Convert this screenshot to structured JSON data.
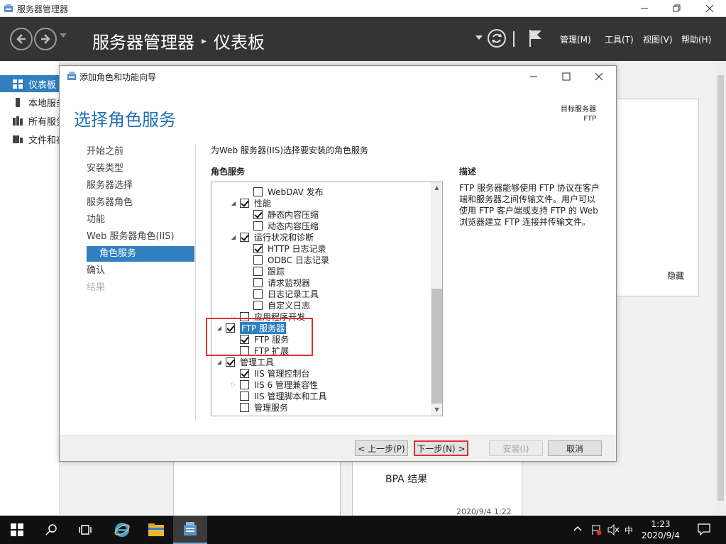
{
  "outer": {
    "window_title": "服务器管理器",
    "breadcrumb_app": "服务器管理器",
    "breadcrumb_sep": "▸",
    "breadcrumb_page": "仪表板",
    "menus": [
      "管理(M)",
      "工具(T)",
      "视图(V)",
      "帮助(H)"
    ],
    "sidebar": [
      {
        "label": "仪表板",
        "icon": "dashboard-icon",
        "active": true
      },
      {
        "label": "本地服务器",
        "icon": "local-server-icon"
      },
      {
        "label": "所有服务器",
        "icon": "all-servers-icon"
      },
      {
        "label": "文件和存储服务",
        "icon": "file-storage-icon"
      }
    ],
    "panel_hide": "隐藏",
    "bpa_label": "BPA 结果",
    "bpa_date": "2020/9/4 1:22"
  },
  "wizard": {
    "title": "添加角色和功能向导",
    "heading": "选择角色服务",
    "target_label": "目标服务器",
    "target_value": "FTP",
    "steps": [
      {
        "label": "开始之前",
        "state": "normal"
      },
      {
        "label": "安装类型",
        "state": "normal"
      },
      {
        "label": "服务器选择",
        "state": "normal"
      },
      {
        "label": "服务器角色",
        "state": "normal"
      },
      {
        "label": "功能",
        "state": "normal"
      },
      {
        "label": "Web 服务器角色(IIS)",
        "state": "normal"
      },
      {
        "label": "角色服务",
        "state": "active"
      },
      {
        "label": "确认",
        "state": "normal"
      },
      {
        "label": "结果",
        "state": "disabled"
      }
    ],
    "instruction": "为Web 服务器(IIS)选择要安装的角色服务",
    "section_label": "角色服务",
    "description_label": "描述",
    "description_text": "FTP 服务器能够使用 FTP 协议在客户端和服务器之间传输文件。用户可以使用 FTP 客户端或支持 FTP 的 Web 浏览器建立 FTP 连接并传输文件。",
    "tree": [
      {
        "label": "WebDAV 发布",
        "level": 3,
        "checked": false,
        "expander": ""
      },
      {
        "label": "性能",
        "level": 2,
        "checked": true,
        "expander": "open"
      },
      {
        "label": "静态内容压缩",
        "level": 3,
        "checked": true,
        "expander": ""
      },
      {
        "label": "动态内容压缩",
        "level": 3,
        "checked": false,
        "expander": ""
      },
      {
        "label": "运行状况和诊断",
        "level": 2,
        "checked": true,
        "expander": "open"
      },
      {
        "label": "HTTP 日志记录",
        "level": 3,
        "checked": true,
        "expander": ""
      },
      {
        "label": "ODBC 日志记录",
        "level": 3,
        "checked": false,
        "expander": ""
      },
      {
        "label": "跟踪",
        "level": 3,
        "checked": false,
        "expander": ""
      },
      {
        "label": "请求监视器",
        "level": 3,
        "checked": false,
        "expander": ""
      },
      {
        "label": "日志记录工具",
        "level": 3,
        "checked": false,
        "expander": ""
      },
      {
        "label": "自定义日志",
        "level": 3,
        "checked": false,
        "expander": ""
      },
      {
        "label": "应用程序开发",
        "level": 2,
        "checked": false,
        "expander": "closed"
      },
      {
        "label": "FTP 服务器",
        "level": 1,
        "checked": true,
        "expander": "open",
        "selected": true
      },
      {
        "label": "FTP 服务",
        "level": 2,
        "checked": true,
        "expander": ""
      },
      {
        "label": "FTP 扩展",
        "level": 2,
        "checked": false,
        "expander": ""
      },
      {
        "label": "管理工具",
        "level": 1,
        "checked": true,
        "expander": "open"
      },
      {
        "label": "IIS 管理控制台",
        "level": 2,
        "checked": true,
        "expander": ""
      },
      {
        "label": "IIS 6 管理兼容性",
        "level": 2,
        "checked": false,
        "expander": "closed"
      },
      {
        "label": "IIS 管理脚本和工具",
        "level": 2,
        "checked": false,
        "expander": ""
      },
      {
        "label": "管理服务",
        "level": 2,
        "checked": false,
        "expander": ""
      }
    ],
    "buttons": {
      "prev": "< 上一步(P)",
      "next": "下一步(N) >",
      "install": "安装(I)",
      "cancel": "取消"
    }
  },
  "taskbar": {
    "ime": "中",
    "time": "1:23",
    "date": "2020/9/4"
  },
  "colors": {
    "accent": "#2f7fc1",
    "header_bg": "#343434",
    "highlight": "#e0302c"
  }
}
